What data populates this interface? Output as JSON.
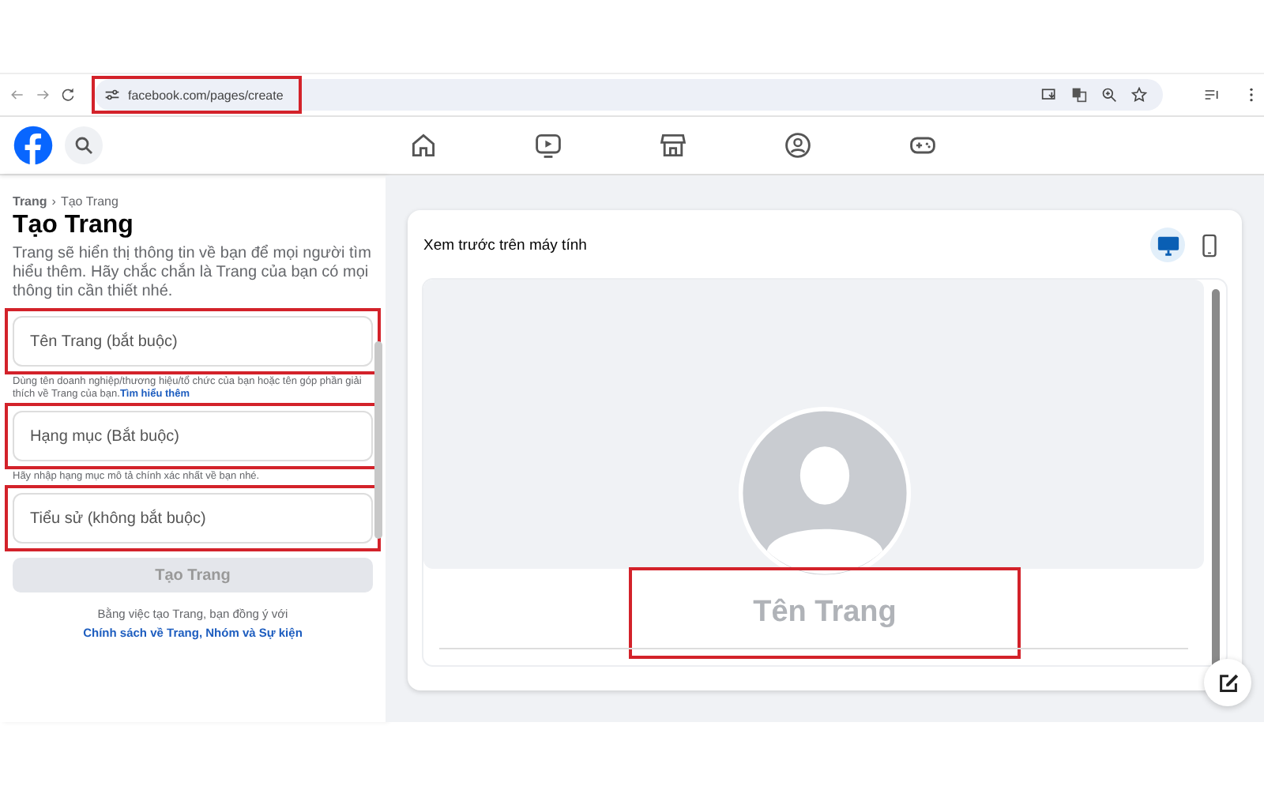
{
  "browser": {
    "url": "facebook.com/pages/create",
    "url_highlighted": true
  },
  "nav": {
    "tabs": [
      {
        "kind": "home"
      },
      {
        "kind": "video"
      },
      {
        "kind": "store"
      },
      {
        "kind": "groups"
      },
      {
        "kind": "gaming"
      }
    ]
  },
  "form": {
    "breadcrumb": [
      {
        "label": "Trang",
        "kind": "link"
      },
      {
        "label": "›",
        "kind": "sep"
      },
      {
        "label": "Tạo Trang",
        "kind": "current"
      }
    ],
    "title": "Tạo Trang",
    "description": "Trang sẽ hiển thị thông tin về bạn để mọi người tìm hiểu thêm. Hãy chắc chắn là Trang của bạn có mọi thông tin cần thiết nhé.",
    "fields": [
      {
        "placeholder": "Tên Trang (bắt buộc)",
        "highlighted": true,
        "hint": "Dùng tên doanh nghiệp/thương hiệu/tổ chức của bạn hoặc tên góp phần giải thích về Trang của bạn.",
        "hint_link": "Tìm hiểu thêm"
      },
      {
        "placeholder": "Hạng mục (Bắt buộc)",
        "highlighted": true,
        "hint": "Hãy nhập hạng mục mô tả chính xác nhất về bạn nhé."
      },
      {
        "placeholder": "Tiểu sử (không bắt buộc)",
        "highlighted": true
      }
    ],
    "submit": {
      "label": "Tạo Trang",
      "disabled": true
    },
    "terms": "Bằng việc tạo Trang, bạn đồng ý với",
    "terms_link": "Chính sách về Trang, Nhóm và Sự kiện"
  },
  "preview": {
    "title": "Xem trước trên máy tính",
    "devices": [
      {
        "kind": "desktop",
        "selected": true
      },
      {
        "kind": "mobile",
        "selected": false
      }
    ],
    "page_name": "Tên Trang",
    "name_highlighted": true
  }
}
